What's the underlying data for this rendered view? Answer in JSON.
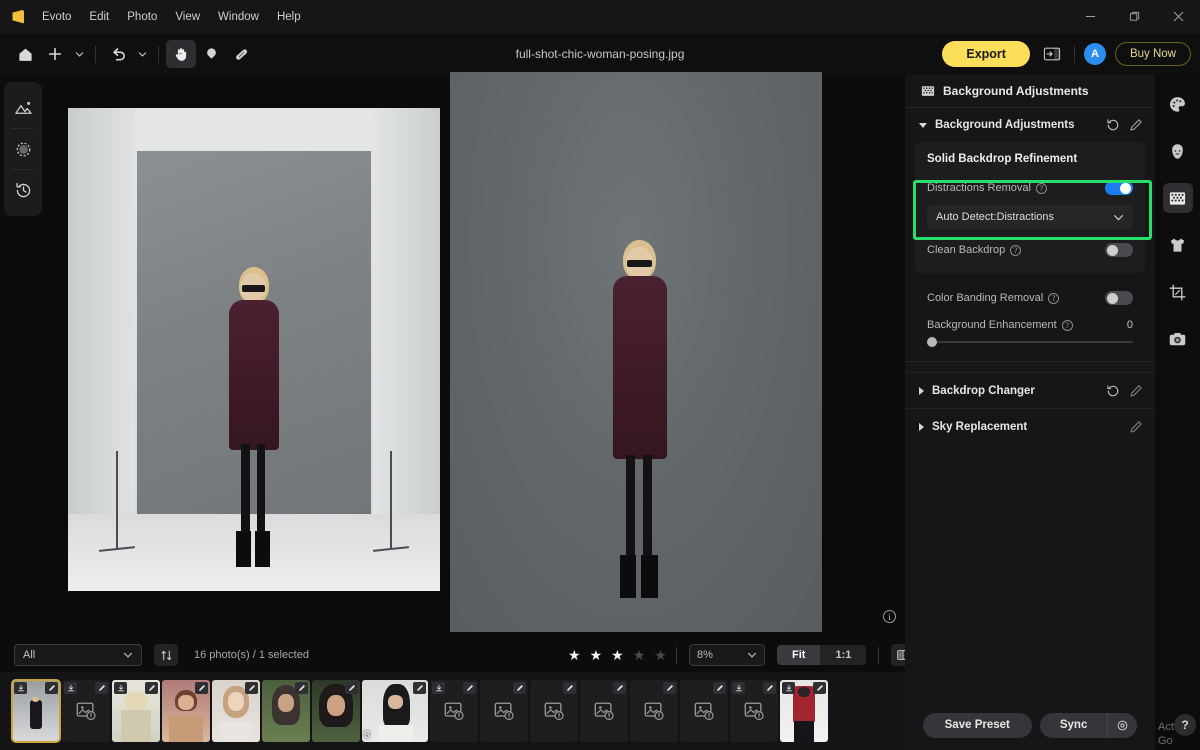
{
  "window": {
    "app_name": "Evoto",
    "document_title": "full-shot-chic-woman-posing.jpg",
    "menus": [
      "Evoto",
      "Edit",
      "Photo",
      "View",
      "Window",
      "Help"
    ],
    "controls": {
      "minimize": "minimize-icon",
      "maximize": "maximize-icon",
      "close": "close-icon"
    }
  },
  "toolbar": {
    "home_icon": "home-icon",
    "add_icon": "plus-icon",
    "add_caret": "chevron-down-icon",
    "undo_icon": "undo-icon",
    "undo_caret": "chevron-down-icon",
    "hand_icon": "hand-tool-icon",
    "retouch_icon": "retouch-brush-icon",
    "heal_icon": "bandage-heal-icon",
    "export_label": "Export",
    "panel_toggle_icon": "toggle-panel-icon",
    "avatar_initial": "A",
    "buy_label": "Buy Now"
  },
  "left_rail": {
    "items": [
      {
        "name": "image-tools-icon",
        "label": "Image"
      },
      {
        "name": "mask-icon",
        "label": "Mask"
      },
      {
        "name": "history-icon",
        "label": "History"
      }
    ]
  },
  "right_rail": {
    "items": [
      {
        "name": "palette-icon",
        "label": "Color",
        "active": false
      },
      {
        "name": "face-icon",
        "label": "Face",
        "active": false
      },
      {
        "name": "background-icon",
        "label": "Background",
        "active": true
      },
      {
        "name": "clothing-icon",
        "label": "Clothing",
        "active": false
      },
      {
        "name": "crop-icon",
        "label": "Crop",
        "active": false
      },
      {
        "name": "camera-icon",
        "label": "Camera",
        "active": false
      }
    ]
  },
  "canvas": {
    "info_icon": "info-icon",
    "before_label": "before-image",
    "after_label": "after-image"
  },
  "bottom_bar": {
    "filter_value": "All",
    "filter_caret": "chevron-down-icon",
    "sort_icon": "sort-icon",
    "photo_count": "16 photo(s) / 1 selected",
    "rating": {
      "filled": 3,
      "total": 5
    },
    "zoom_value": "8%",
    "zoom_caret": "chevron-down-icon",
    "fit_label": "Fit",
    "one_to_one_label": "1:1",
    "compare_icon": "compare-view-icon"
  },
  "filmstrip": {
    "thumbnails": [
      {
        "kind": "photo",
        "selected": true,
        "badge_edit": true,
        "badge_dl": true,
        "num": ""
      },
      {
        "kind": "placeholder",
        "selected": false,
        "badge_edit": true,
        "badge_dl": true,
        "num": ""
      },
      {
        "kind": "photo",
        "selected": false,
        "badge_edit": true,
        "badge_dl": true,
        "num": ""
      },
      {
        "kind": "photo",
        "selected": false,
        "badge_edit": true,
        "badge_dl": false,
        "num": ""
      },
      {
        "kind": "photo",
        "selected": false,
        "badge_edit": true,
        "badge_dl": false,
        "num": ""
      },
      {
        "kind": "photo",
        "selected": false,
        "badge_edit": true,
        "badge_dl": false,
        "num": ""
      },
      {
        "kind": "photo",
        "selected": false,
        "badge_edit": true,
        "badge_dl": false,
        "num": ""
      },
      {
        "kind": "photo",
        "selected": false,
        "badge_edit": true,
        "badge_dl": false,
        "num": "8"
      },
      {
        "kind": "placeholder",
        "selected": false,
        "badge_edit": true,
        "badge_dl": true,
        "num": ""
      },
      {
        "kind": "placeholder",
        "selected": false,
        "badge_edit": true,
        "badge_dl": false,
        "num": ""
      },
      {
        "kind": "placeholder",
        "selected": false,
        "badge_edit": true,
        "badge_dl": false,
        "num": ""
      },
      {
        "kind": "placeholder",
        "selected": false,
        "badge_edit": true,
        "badge_dl": false,
        "num": ""
      },
      {
        "kind": "placeholder",
        "selected": false,
        "badge_edit": true,
        "badge_dl": false,
        "num": ""
      },
      {
        "kind": "placeholder",
        "selected": false,
        "badge_edit": true,
        "badge_dl": false,
        "num": ""
      },
      {
        "kind": "placeholder",
        "selected": false,
        "badge_edit": true,
        "badge_dl": true,
        "num": ""
      },
      {
        "kind": "photo",
        "selected": false,
        "badge_edit": true,
        "badge_dl": true,
        "num": ""
      }
    ]
  },
  "panel": {
    "header": {
      "icon": "background-icon",
      "title": "Background Adjustments"
    },
    "group": {
      "title": "Background Adjustments",
      "expanded": true,
      "reset_icon": "reset-icon",
      "edit_icon": "edit-pencil-icon"
    },
    "solid_backdrop": {
      "title": "Solid Backdrop Refinement",
      "distractions_removal": {
        "label": "Distractions Removal",
        "help_icon": "help-icon",
        "enabled": true,
        "dropdown_value": "Auto Detect:Distractions",
        "dropdown_caret": "chevron-down-icon",
        "highlighted": true
      },
      "clean_backdrop": {
        "label": "Clean Backdrop",
        "help_icon": "help-icon",
        "enabled": false
      }
    },
    "color_banding_removal": {
      "label": "Color Banding Removal",
      "help_icon": "help-icon",
      "enabled": false
    },
    "background_enhancement": {
      "label": "Background Enhancement",
      "help_icon": "help-icon",
      "value": "0",
      "min": 0,
      "max": 100
    },
    "collapsed_sections": [
      {
        "title": "Backdrop Changer",
        "reset_icon": "reset-icon",
        "edit_icon": "edit-pencil-icon",
        "has_reset": true
      },
      {
        "title": "Sky Replacement",
        "reset_icon": "",
        "edit_icon": "edit-pencil-icon",
        "has_reset": false
      }
    ],
    "footer": {
      "save_preset_label": "Save Preset",
      "sync_label": "Sync",
      "sync_settings_icon": "gear-icon"
    }
  },
  "overlay": {
    "help_fab": "?",
    "watermark_line1": "Act",
    "watermark_line2": "Go"
  },
  "colors": {
    "accent_yellow": "#fbde5a",
    "accent_blue": "#1a7df0",
    "highlight_green": "#27e06a",
    "selection_gold": "#caa63b",
    "panel_bg": "#161618",
    "app_bg": "#0c0c0d"
  }
}
